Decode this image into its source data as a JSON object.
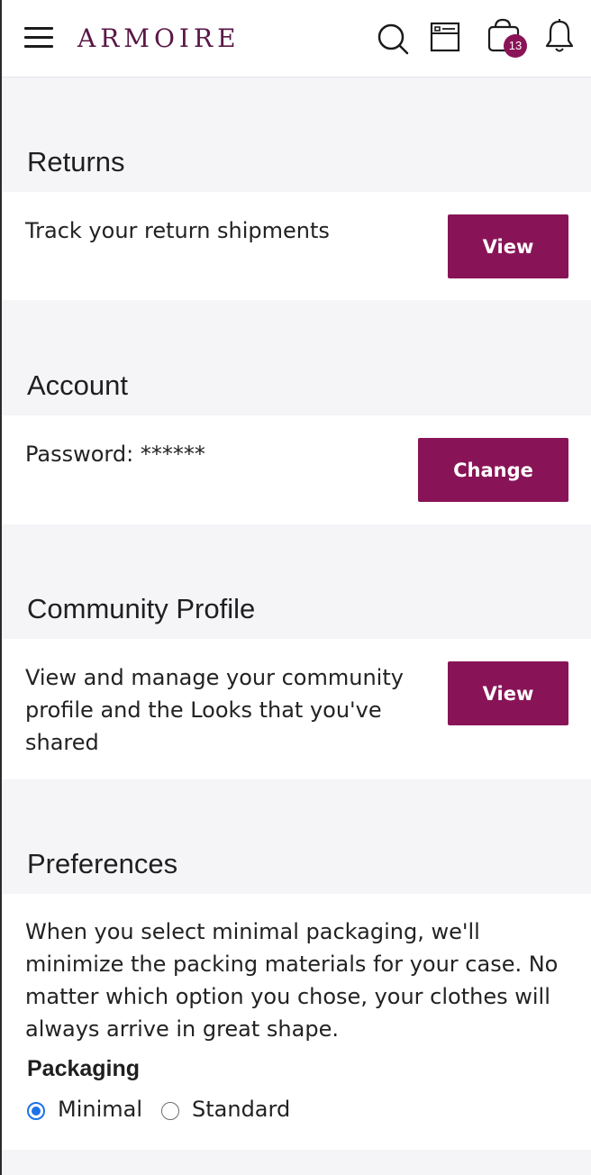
{
  "header": {
    "logo_text": "ARMOIRE",
    "icons": [
      "menu-icon",
      "search-icon",
      "closet-icon",
      "shopping-bag-icon",
      "bell-icon"
    ],
    "cart_badge": "13",
    "brand_color": "#881457"
  },
  "returns": {
    "title": "Returns",
    "description": "Track your return shipments",
    "button_label": "View"
  },
  "account": {
    "title": "Account",
    "password_label": "Password: ******",
    "button_label": "Change"
  },
  "community": {
    "title": "Community Profile",
    "description": "View and manage your community profile and the Looks that you've shared",
    "button_label": "View"
  },
  "preferences": {
    "title": "Preferences",
    "description": "When you select minimal packaging, we'll minimize the packing materials for your case. No matter which option you chose, your clothes will always arrive in great shape.",
    "packaging_label": "Packaging",
    "options": [
      {
        "label": "Minimal",
        "selected": true
      },
      {
        "label": "Standard",
        "selected": false
      }
    ]
  }
}
